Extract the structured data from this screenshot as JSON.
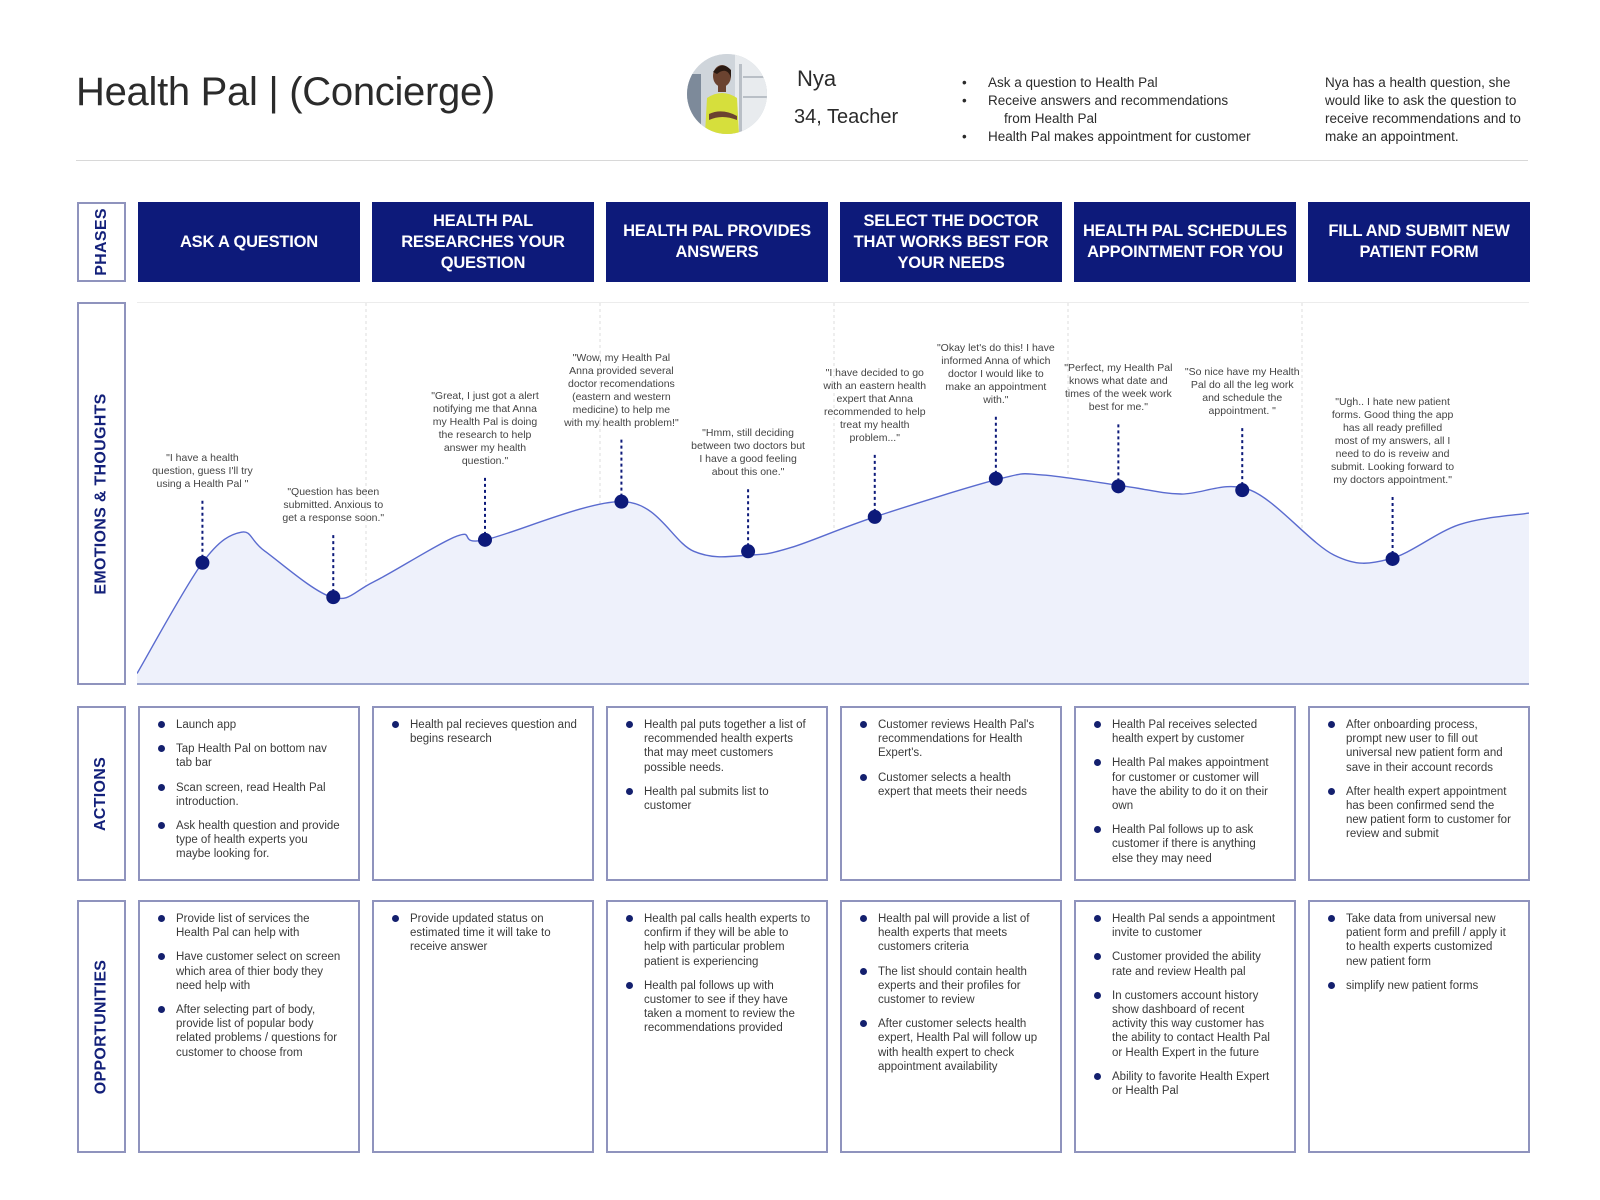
{
  "header": {
    "title": "Health Pal | (Concierge)",
    "persona": {
      "name": "Nya",
      "subtitle": "34, Teacher",
      "avatar_icon": "persona-photo"
    },
    "goals": [
      {
        "text": "Ask a question to Health Pal"
      },
      {
        "text": "Receive answers and recommendations",
        "continuation": "from Health Pal"
      },
      {
        "text": "Health Pal makes appointment for customer"
      }
    ],
    "goal_bullet": "•",
    "scenario": "Nya has a health question, she would like to ask the question to receive recommendations and to make an appointment."
  },
  "row_labels": {
    "phases": "PHASES",
    "emotions": "EMOTIONS & THOUGHTS",
    "actions": "ACTIONS",
    "opportunities": "OPPORTUNITIES"
  },
  "colors": {
    "phase_bg": "#0d1a7a",
    "label_text": "#13207a",
    "border": "#8f93bd",
    "curve_line": "#5a6bcf",
    "curve_fill": "#eef1fb",
    "point": "#0d1a7a"
  },
  "phases": [
    {
      "label": "ASK A QUESTION"
    },
    {
      "label": "HEALTH PAL RESEARCHES YOUR QUESTION"
    },
    {
      "label": "HEALTH PAL PROVIDES ANSWERS"
    },
    {
      "label": "SELECT THE DOCTOR THAT WORKS BEST FOR YOUR NEEDS"
    },
    {
      "label": "HEALTH PAL SCHEDULES APPOINTMENT FOR YOU"
    },
    {
      "label": "FILL AND  SUBMIT NEW PATIENT FORM"
    }
  ],
  "chart_data": {
    "type": "line",
    "title": "Emotions & Thoughts",
    "xlabel": "",
    "ylabel": "",
    "note": "Emotion level on a relative 0-100 scale (higher = more positive); x is position along the journey 0-100",
    "ylim": [
      0,
      100
    ],
    "xlim": [
      0,
      100
    ],
    "curve": [
      [
        0,
        3
      ],
      [
        4.7,
        32
      ],
      [
        7.5,
        40
      ],
      [
        9.2,
        35
      ],
      [
        14,
        23
      ],
      [
        17,
        27
      ],
      [
        23,
        39
      ],
      [
        25,
        38
      ],
      [
        35,
        48
      ],
      [
        40,
        35
      ],
      [
        44,
        34
      ],
      [
        47,
        36
      ],
      [
        53,
        44
      ],
      [
        62,
        54
      ],
      [
        65,
        55
      ],
      [
        71,
        52
      ],
      [
        75,
        50
      ],
      [
        80,
        51
      ],
      [
        86,
        34
      ],
      [
        90,
        33
      ],
      [
        95,
        42
      ],
      [
        100,
        45
      ]
    ],
    "points": [
      {
        "x": 4.7,
        "y": 32,
        "quote": "\"I have a health question, guess I'll try using a Health Pal \""
      },
      {
        "x": 14.1,
        "y": 23,
        "quote": "\"Question has been submitted. Anxious to get a response soon.\""
      },
      {
        "x": 25.0,
        "y": 38,
        "quote": "\"Great, I just got a alert notifying me that Anna my Health Pal is doing the research to help answer my health question.\""
      },
      {
        "x": 34.8,
        "y": 48,
        "quote": "\"Wow, my Health Pal Anna provided several doctor recomendations (eastern and western medicine) to help me with my health problem!\""
      },
      {
        "x": 43.9,
        "y": 35,
        "quote": "\"Hmm, still deciding between two doctors but I have a good feeling about this one.\""
      },
      {
        "x": 53.0,
        "y": 44,
        "quote": "\"I have decided to go with an eastern health expert that Anna recommended to help treat my health problem...\""
      },
      {
        "x": 61.7,
        "y": 54,
        "quote": "\"Okay let's do this! I have informed Anna of which doctor I would like to make an appointment with.\""
      },
      {
        "x": 70.5,
        "y": 52,
        "quote": "\"Perfect, my Health Pal knows what date and times of the week work best for me.\""
      },
      {
        "x": 79.4,
        "y": 51,
        "quote": "\"So nice have my Health Pal do all the leg work and schedule the appointment. \""
      },
      {
        "x": 90.2,
        "y": 33,
        "quote": "\"Ugh.. I hate new patient forms. Good thing the app has all ready prefilled most of my answers, all I need to do is reveiw and submit. Looking forward to my doctors appointment.\""
      }
    ]
  },
  "actions": [
    [
      "Launch app",
      "Tap Health Pal on bottom nav tab bar",
      "Scan screen, read Health Pal introduction.",
      "Ask health question and provide type of health experts you maybe looking for."
    ],
    [
      "Health pal recieves question and begins research"
    ],
    [
      "Health pal puts together a list of recommended health experts that may meet customers possible needs.",
      "Health pal submits list to customer"
    ],
    [
      "Customer reviews Health Pal's recommendations for Health Expert's.",
      "Customer selects a health expert that meets their needs"
    ],
    [
      "Health Pal receives selected health expert by customer",
      "Health Pal makes appointment for customer or customer will have the ability to do it on their own",
      "Health Pal follows up to ask customer if there is anything else they may need"
    ],
    [
      "After onboarding process, prompt new user to fill out universal new patient form and save in their account records",
      "After health expert appointment has been confirmed send the new patient form to customer for review and submit"
    ]
  ],
  "opportunities": [
    [
      "Provide list of services the Health Pal can help with",
      "Have customer select on screen which area of thier body they need help with",
      "After selecting part of body, provide list of popular body related problems / questions for customer to choose from"
    ],
    [
      "Provide updated status on estimated time it will take to receive answer"
    ],
    [
      "Health pal calls health experts to confirm if they will be able to help with particular problem patient is experiencing",
      "Health pal follows up with customer to see if they have taken a moment to review the recommendations provided"
    ],
    [
      "Health pal will provide a list of health experts that meets customers criteria",
      "The list should contain health experts and their profiles for customer to review",
      "After customer selects health expert, Health Pal will follow up with health expert to check appointment availability"
    ],
    [
      "Health Pal sends a appointment invite to customer",
      "Customer provided the ability rate and review Health pal",
      "In customers account history show dashboard of recent activity this way customer has the ability to contact Health Pal or Health Expert in the future",
      "Ability to favorite Health Expert or Health Pal"
    ],
    [
      "Take data from universal new patient form and prefill / apply it to health experts customized new patient form",
      "simplify new patient forms"
    ]
  ]
}
